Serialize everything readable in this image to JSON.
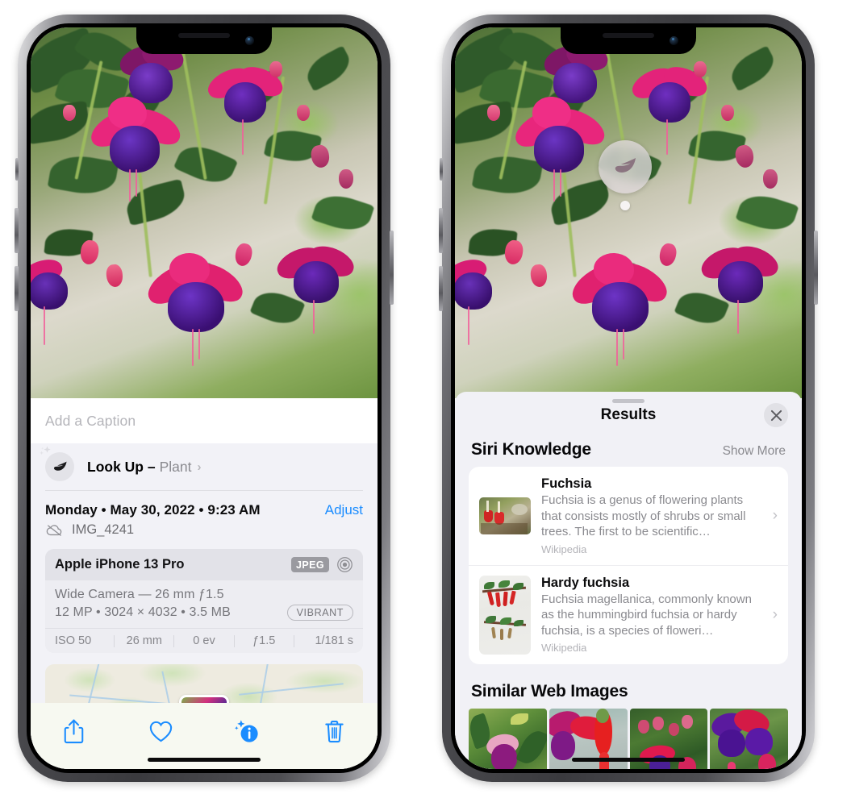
{
  "left_phone": {
    "name": "photos-detail-view",
    "caption": {
      "placeholder": "Add a Caption",
      "value": ""
    },
    "look_up": {
      "label": "Look Up –",
      "subject": "Plant",
      "icon": "leaf-icon",
      "sparkle_icon": "sparkles-icon",
      "chevron": "›"
    },
    "date": "Monday • May 30, 2022 • 9:23 AM",
    "adjust_label": "Adjust",
    "file_name": "IMG_4241",
    "cloud_icon": "icloud-slash-icon",
    "camera_card": {
      "device": "Apple iPhone 13 Pro",
      "format_badge": "JPEG",
      "raw_icon": "aperture-icon",
      "lens_line": "Wide Camera — 26 mm ƒ1.5",
      "specs_line": "12 MP • 3024 × 4032 • 3.5 MB",
      "style_badge": "VIBRANT",
      "exif": [
        "ISO 50",
        "26 mm",
        "0 ev",
        "ƒ1.5",
        "1/181 s"
      ]
    },
    "toolbar": {
      "share_label": "Share",
      "favorite_label": "Favorite",
      "info_label": "Info",
      "delete_label": "Delete",
      "share_icon": "share-icon",
      "favorite_icon": "heart-icon",
      "info_icon": "info-sparkle-icon",
      "delete_icon": "trash-icon",
      "accent_color": "#1a8cff"
    }
  },
  "right_phone": {
    "name": "visual-look-up-results",
    "photo_badge": {
      "icon": "leaf-icon",
      "label": "Plant"
    },
    "sheet": {
      "title": "Results",
      "close_icon": "close-icon",
      "grabber": "drag-handle"
    },
    "siri_knowledge": {
      "heading": "Siri Knowledge",
      "show_more": "Show More",
      "items": [
        {
          "title": "Fuchsia",
          "description": "Fuchsia is a genus of flowering plants that consists mostly of shrubs or small trees. The first to be scientific…",
          "source": "Wikipedia",
          "thumb": "fuchsia-red-flowers-thumbnail",
          "chevron": "›"
        },
        {
          "title": "Hardy fuchsia",
          "description": "Fuchsia magellanica, commonly known as the hummingbird fuchsia or hardy fuchsia, is a species of floweri…",
          "source": "Wikipedia",
          "thumb": "hardy-fuchsia-specimen-thumbnail",
          "chevron": "›"
        }
      ]
    },
    "similar_web_images": {
      "heading": "Similar Web Images",
      "items": [
        {
          "alt": "pink-purple-fuchsia-with-leaves"
        },
        {
          "alt": "red-fuchsia-closeup"
        },
        {
          "alt": "fuchsia-bush-with-buds"
        },
        {
          "alt": "purple-red-fuchsia-cluster"
        }
      ]
    }
  },
  "theme": {
    "accent": "#1a8cff",
    "sheet_bg": "#f1f1f6",
    "card_bg": "#ffffff",
    "text_primary": "#0b0b0c",
    "text_secondary": "#8a8a8f"
  }
}
